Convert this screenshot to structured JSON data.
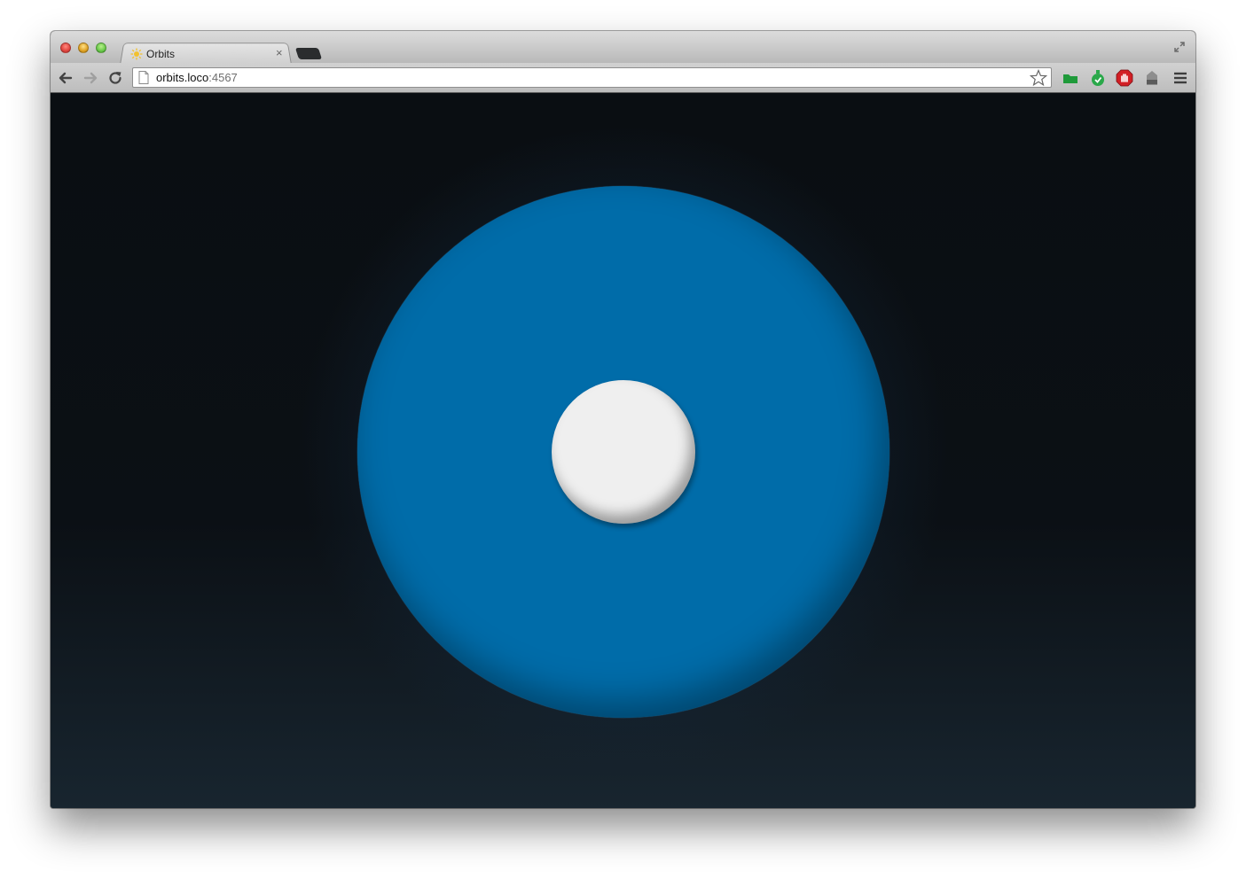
{
  "browser": {
    "tab": {
      "title": "Orbits",
      "close_glyph": "×",
      "favicon": "sun-favicon-icon"
    },
    "toolbar": {
      "back_icon": "back-arrow-icon",
      "forward_icon": "forward-arrow-icon",
      "reload_icon": "reload-icon",
      "url_host": "orbits.loco",
      "url_port": ":4567",
      "bookmark_icon": "star-icon",
      "extensions": [
        "green-folder-extension-icon",
        "green-bottle-extension-icon",
        "red-stop-hand-extension-icon",
        "tag-extension-icon"
      ],
      "menu_icon": "hamburger-menu-icon"
    }
  },
  "scene": {
    "background_color": "#0a0e12",
    "orbit_color": "#006ca9",
    "planet_color": "#efefef"
  }
}
